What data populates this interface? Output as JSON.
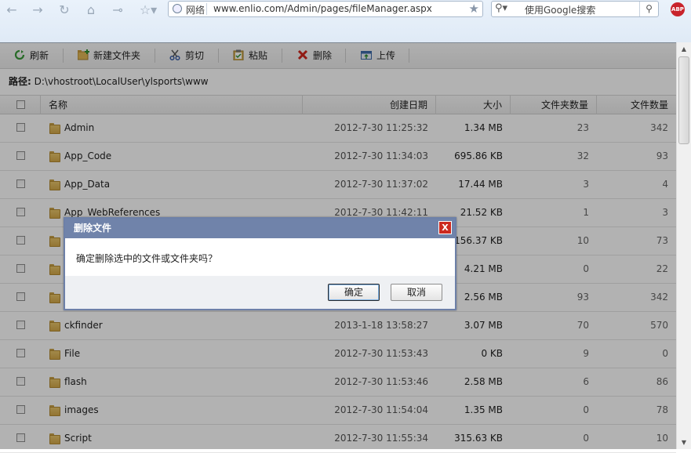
{
  "browser": {
    "zone_label": "网络",
    "url": "www.enlio.com/Admin/pages/fileManager.aspx",
    "search_placeholder": "使用Google搜索",
    "addon_badge": "ABP",
    "nav_icons": [
      "back-icon",
      "forward-icon",
      "reload-icon",
      "home-icon",
      "key-icon",
      "favorites-icon"
    ]
  },
  "toolbar": {
    "refresh": "刷新",
    "new_folder": "新建文件夹",
    "cut": "剪切",
    "paste": "粘贴",
    "delete": "删除",
    "upload": "上传"
  },
  "path": {
    "label": "路径:",
    "value": "D:\\vhostroot\\LocalUser\\ylsports\\www"
  },
  "table": {
    "headers": {
      "name": "名称",
      "created": "创建日期",
      "size": "大小",
      "folder_count": "文件夹数量",
      "file_count": "文件数量"
    },
    "rows": [
      {
        "name": "Admin",
        "created": "2012-7-30 11:25:32",
        "size": "1.34 MB",
        "folders": "23",
        "files": "342"
      },
      {
        "name": "App_Code",
        "created": "2012-7-30 11:34:03",
        "size": "695.86 KB",
        "folders": "32",
        "files": "93"
      },
      {
        "name": "App_Data",
        "created": "2012-7-30 11:37:02",
        "size": "17.44 MB",
        "folders": "3",
        "files": "4"
      },
      {
        "name": "App_WebReferences",
        "created": "2012-7-30 11:42:11",
        "size": "21.52 KB",
        "folders": "1",
        "files": "3"
      },
      {
        "name": "",
        "created": "",
        "size": "156.37 KB",
        "folders": "10",
        "files": "73"
      },
      {
        "name": "",
        "created": "",
        "size": "4.21 MB",
        "folders": "0",
        "files": "22"
      },
      {
        "name": "",
        "created": "",
        "size": "2.56 MB",
        "folders": "93",
        "files": "342"
      },
      {
        "name": "ckfinder",
        "created": "2013-1-18 13:58:27",
        "size": "3.07 MB",
        "folders": "70",
        "files": "570"
      },
      {
        "name": "File",
        "created": "2012-7-30 11:53:43",
        "size": "0 KB",
        "folders": "9",
        "files": "0"
      },
      {
        "name": "flash",
        "created": "2012-7-30 11:53:46",
        "size": "2.58 MB",
        "folders": "6",
        "files": "86"
      },
      {
        "name": "images",
        "created": "2012-7-30 11:54:04",
        "size": "1.35 MB",
        "folders": "0",
        "files": "78"
      },
      {
        "name": "Script",
        "created": "2012-7-30 11:55:34",
        "size": "315.63 KB",
        "folders": "0",
        "files": "10"
      }
    ]
  },
  "dialog": {
    "title": "删除文件",
    "message": "确定删除选中的文件或文件夹吗？",
    "ok": "确定",
    "cancel": "取消",
    "close": "X"
  },
  "colors": {
    "dialog_title_bg": "#7083aa",
    "close_button": "#cc2a20",
    "overlay": "rgba(0,0,0,0.30)"
  }
}
